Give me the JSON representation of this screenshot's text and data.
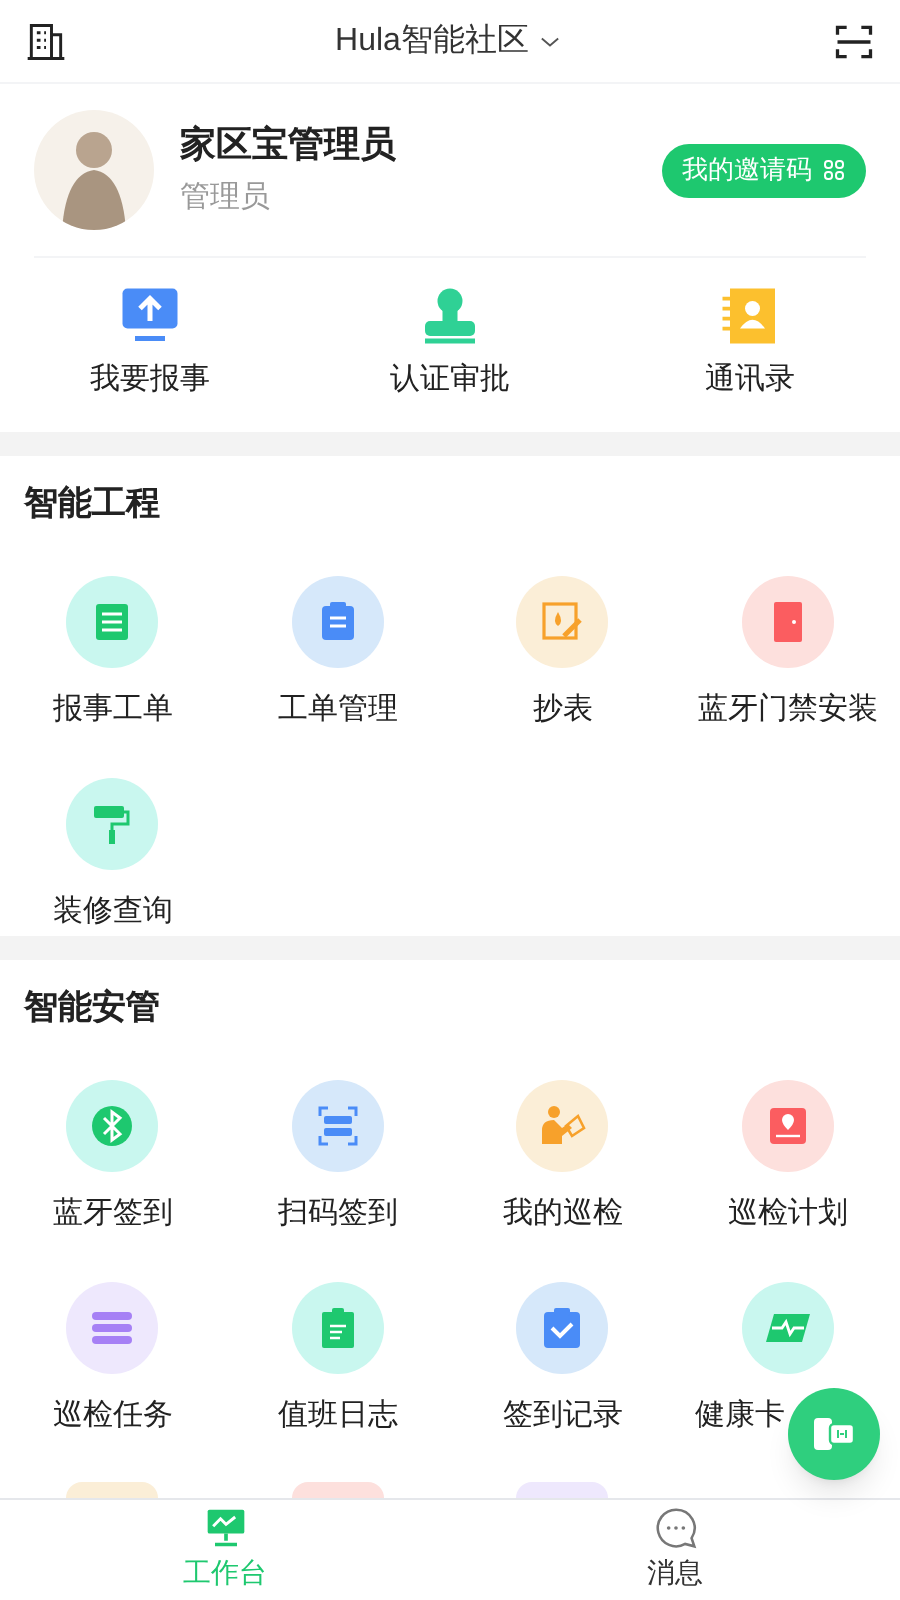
{
  "header": {
    "title": "Hula智能社区"
  },
  "profile": {
    "name": "家区宝管理员",
    "role": "管理员",
    "invite_button": "我的邀请码"
  },
  "quick_actions": [
    {
      "label": "我要报事"
    },
    {
      "label": "认证审批"
    },
    {
      "label": "通讯录"
    }
  ],
  "sections": [
    {
      "title": "智能工程",
      "items": [
        {
          "label": "报事工单"
        },
        {
          "label": "工单管理"
        },
        {
          "label": "抄表"
        },
        {
          "label": "蓝牙门禁安装"
        },
        {
          "label": "装修查询"
        }
      ]
    },
    {
      "title": "智能安管",
      "items": [
        {
          "label": "蓝牙签到"
        },
        {
          "label": "扫码签到"
        },
        {
          "label": "我的巡检"
        },
        {
          "label": "巡检计划"
        },
        {
          "label": "巡检任务"
        },
        {
          "label": "值班日志"
        },
        {
          "label": "签到记录"
        },
        {
          "label": "健康卡"
        }
      ]
    }
  ],
  "tab_bar": [
    {
      "label": "工作台",
      "selected": true
    },
    {
      "label": "消息",
      "selected": false
    }
  ]
}
